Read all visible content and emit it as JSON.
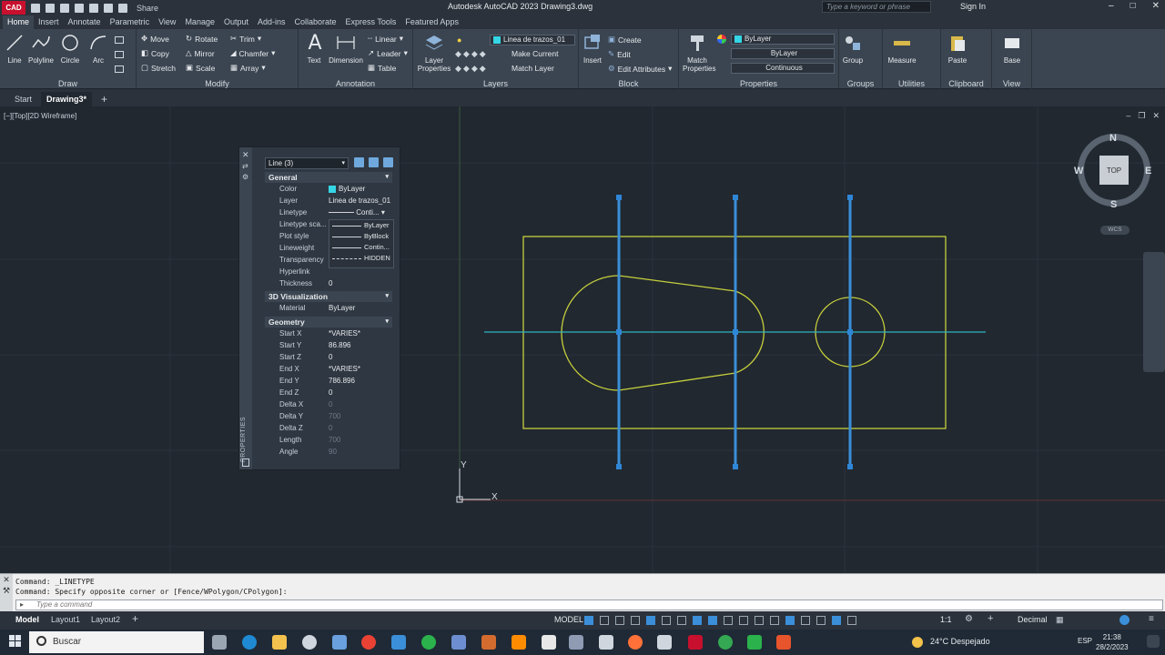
{
  "titlebar": {
    "app_logo": "CAD",
    "share": "Share",
    "title": "Autodesk AutoCAD 2023    Drawing3.dwg",
    "search_placeholder": "Type a keyword or phrase",
    "sign_in": "Sign In"
  },
  "ribbon_tabs": [
    "Home",
    "Insert",
    "Annotate",
    "Parametric",
    "View",
    "Manage",
    "Output",
    "Add-ins",
    "Collaborate",
    "Express Tools",
    "Featured Apps"
  ],
  "ribbon": {
    "draw": {
      "label": "Draw",
      "tools": [
        "Line",
        "Polyline",
        "Circle",
        "Arc"
      ]
    },
    "modify": {
      "label": "Modify",
      "tools": [
        "Move",
        "Rotate",
        "Trim",
        "Copy",
        "Mirror",
        "Chamfer",
        "Stretch",
        "Scale",
        "Array"
      ]
    },
    "annotation": {
      "label": "Annotation",
      "big": [
        "Text",
        "Dimension"
      ],
      "small": [
        "Linear",
        "Leader",
        "Table"
      ]
    },
    "layers": {
      "label": "Layers",
      "big": "Layer Properties",
      "layer_combo": "Linea de trazos_01",
      "small": [
        "Make Current",
        "Match Layer"
      ]
    },
    "block": {
      "label": "Block",
      "big": "Insert",
      "small": [
        "Create",
        "Edit",
        "Edit Attributes"
      ]
    },
    "properties": {
      "label": "Properties",
      "big": "Match Properties",
      "color_combo": "ByLayer",
      "lineweight_combo": "ByLayer",
      "linetype_combo": "Continuous"
    },
    "groups": {
      "label": "Groups",
      "big": "Group"
    },
    "utilities": {
      "label": "Utilities",
      "big": "Measure"
    },
    "clipboard": {
      "label": "Clipboard",
      "big": "Paste"
    },
    "view": {
      "label": "View",
      "big": "Base"
    }
  },
  "file_tabs": {
    "start": "Start",
    "active": "Drawing3*"
  },
  "viewport": {
    "label": "[−][Top][2D Wireframe]"
  },
  "properties_palette": {
    "strip_label": "PROPERTIES",
    "selection": "Line (3)",
    "general_title": "General",
    "general": [
      {
        "name": "Color",
        "value": "ByLayer"
      },
      {
        "name": "Layer",
        "value": "Linea de trazos_01"
      },
      {
        "name": "Linetype",
        "value": "Conti..."
      },
      {
        "name": "Linetype sca...",
        "value": ""
      },
      {
        "name": "Plot style",
        "value": ""
      },
      {
        "name": "Lineweight",
        "value": ""
      },
      {
        "name": "Transparency",
        "value": ""
      },
      {
        "name": "Hyperlink",
        "value": ""
      },
      {
        "name": "Thickness",
        "value": "0"
      }
    ],
    "viz_title": "3D Visualization",
    "viz": [
      {
        "name": "Material",
        "value": "ByLayer"
      }
    ],
    "geom_title": "Geometry",
    "geometry": [
      {
        "name": "Start X",
        "value": "*VARIES*"
      },
      {
        "name": "Start Y",
        "value": "86.896"
      },
      {
        "name": "Start Z",
        "value": "0"
      },
      {
        "name": "End X",
        "value": "*VARIES*"
      },
      {
        "name": "End Y",
        "value": "786.896"
      },
      {
        "name": "End Z",
        "value": "0"
      },
      {
        "name": "Delta X",
        "value": "0"
      },
      {
        "name": "Delta Y",
        "value": "700"
      },
      {
        "name": "Delta Z",
        "value": "0"
      },
      {
        "name": "Length",
        "value": "700"
      },
      {
        "name": "Angle",
        "value": "90"
      }
    ],
    "linetype_options": [
      "ByLayer",
      "ByBlock",
      "Contin...",
      "HIDDEN"
    ]
  },
  "viewcube": {
    "n": "N",
    "s": "S",
    "e": "E",
    "w": "W",
    "top": "TOP",
    "wcs": "WCS"
  },
  "ucs": {
    "x": "X",
    "y": "Y"
  },
  "command": {
    "line1": "Command: _LINETYPE",
    "line2": "Command: Specify opposite corner or [Fence/WPolygon/CPolygon]:",
    "placeholder": "Type a command"
  },
  "layout_tabs": [
    "Model",
    "Layout1",
    "Layout2"
  ],
  "status": {
    "model": "MODEL",
    "scale": "1:1",
    "units": "Decimal"
  },
  "taskbar": {
    "search": "Buscar",
    "weather": "24°C  Despejado",
    "lang": "ESP",
    "time": "21:38",
    "date": "28/2/2023"
  },
  "colors": {
    "geometry": "#c7cf3c",
    "selection": "#3b8fd9",
    "centerline": "#2fb3c4",
    "layer_cyan": "#35d6e6"
  }
}
